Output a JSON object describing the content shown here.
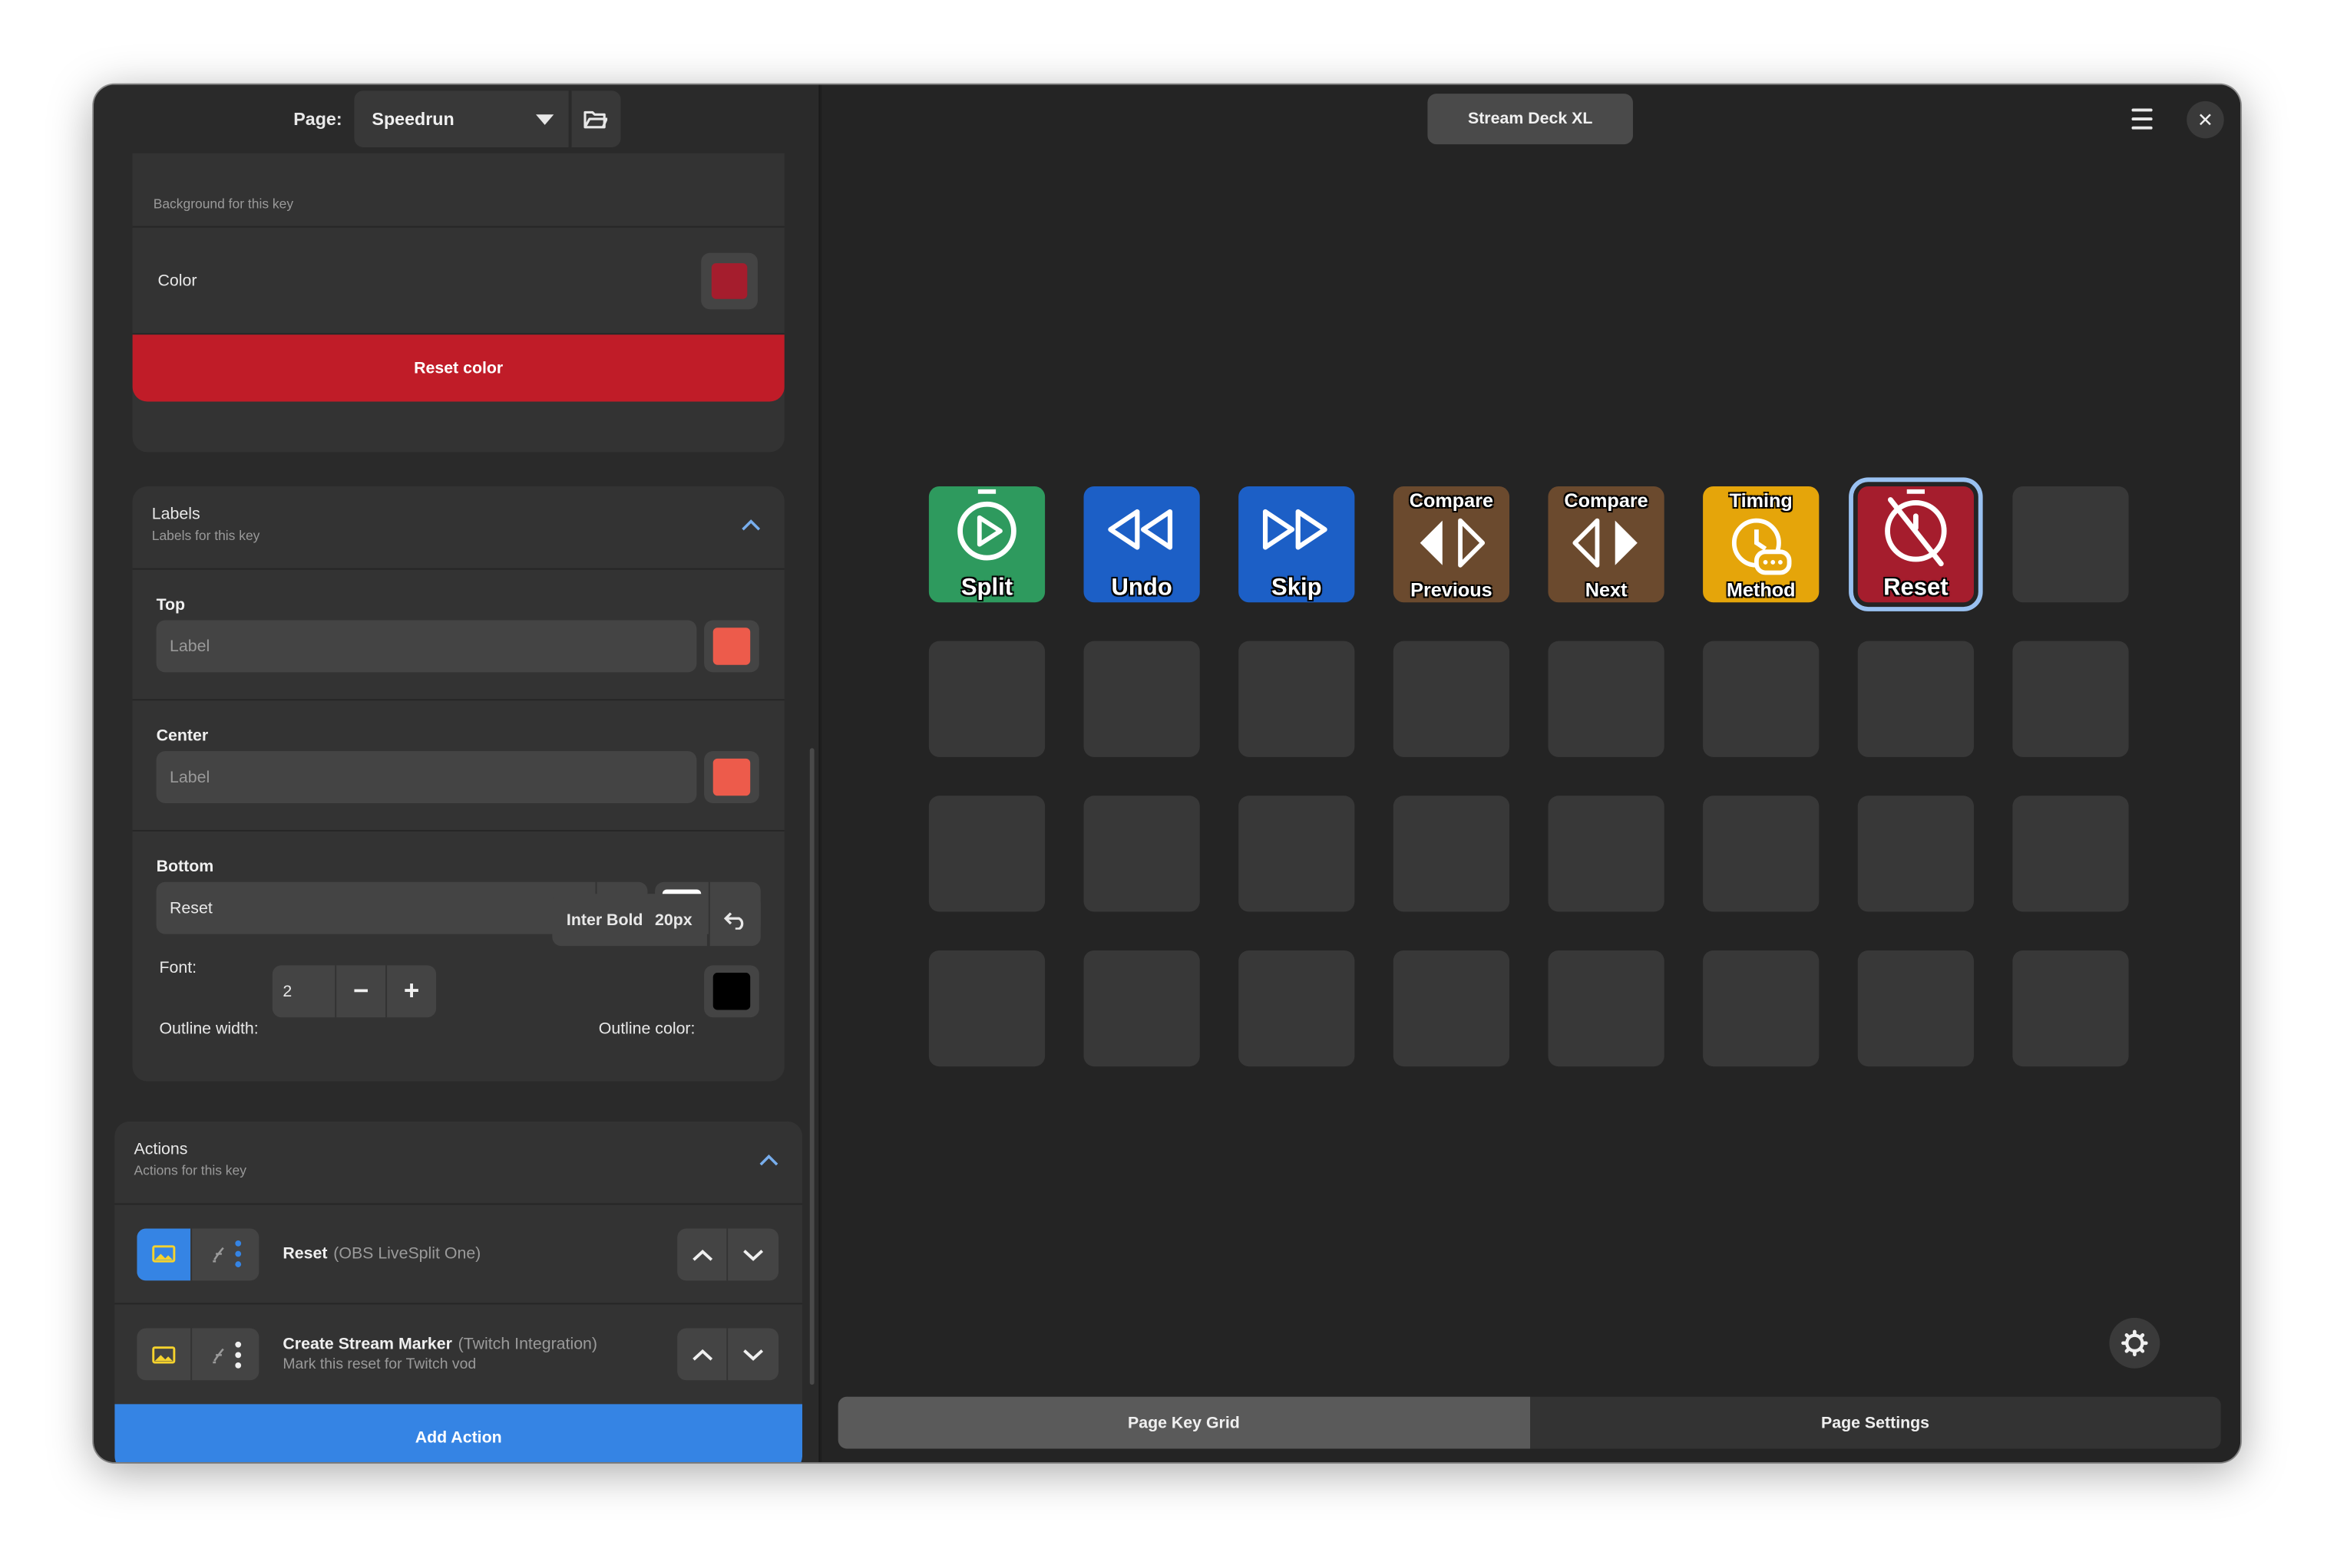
{
  "header": {
    "page_label": "Page:",
    "page_value": "Speedrun",
    "deck_name": "Stream Deck XL"
  },
  "background": {
    "subtitle": "Background for this key",
    "color_label": "Color",
    "color_value": "#a51d2d",
    "reset_label": "Reset color"
  },
  "labels": {
    "title": "Labels",
    "subtitle": "Labels for this key",
    "top": {
      "title": "Top",
      "placeholder": "Label",
      "color": "#ed5b4b"
    },
    "center": {
      "title": "Center",
      "placeholder": "Label",
      "color": "#ed5b4b"
    },
    "bottom": {
      "title": "Bottom",
      "value": "Reset",
      "color": "#ffffff"
    },
    "font_label": "Font:",
    "font_name": "Inter Bold",
    "font_size": "20px",
    "outline_width_label": "Outline width:",
    "outline_width_value": "2",
    "outline_color_label": "Outline color:",
    "outline_color": "#000000"
  },
  "actions": {
    "title": "Actions",
    "subtitle": "Actions for this key",
    "items": [
      {
        "name": "Reset",
        "plugin": "(OBS LiveSplit One)",
        "description": ""
      },
      {
        "name": "Create Stream Marker",
        "plugin": "(Twitch Integration)",
        "description": "Mark this reset for Twitch vod"
      }
    ],
    "add_label": "Add Action"
  },
  "keys": [
    {
      "top": "",
      "bottom": "Split",
      "color": "#2e9a5e",
      "icon": "stopwatch-play-icon"
    },
    {
      "top": "",
      "bottom": "Undo",
      "color": "#1c5fc6",
      "icon": "rewind-icon"
    },
    {
      "top": "",
      "bottom": "Skip",
      "color": "#1c5fc6",
      "icon": "fast-forward-icon"
    },
    {
      "top": "Compare",
      "bottom": "Previous",
      "color": "#6b4a2e",
      "icon": "left-right-arrows-icon"
    },
    {
      "top": "Compare",
      "bottom": "Next",
      "color": "#6b4a2e",
      "icon": "left-right-arrows-icon"
    },
    {
      "top": "Timing",
      "bottom": "Method",
      "color": "#e5a50a",
      "icon": "clock-chat-icon"
    },
    {
      "top": "",
      "bottom": "Reset",
      "color": "#a51d2d",
      "icon": "stopwatch-off-icon"
    }
  ],
  "tabs": {
    "grid": "Page Key Grid",
    "settings": "Page Settings"
  }
}
